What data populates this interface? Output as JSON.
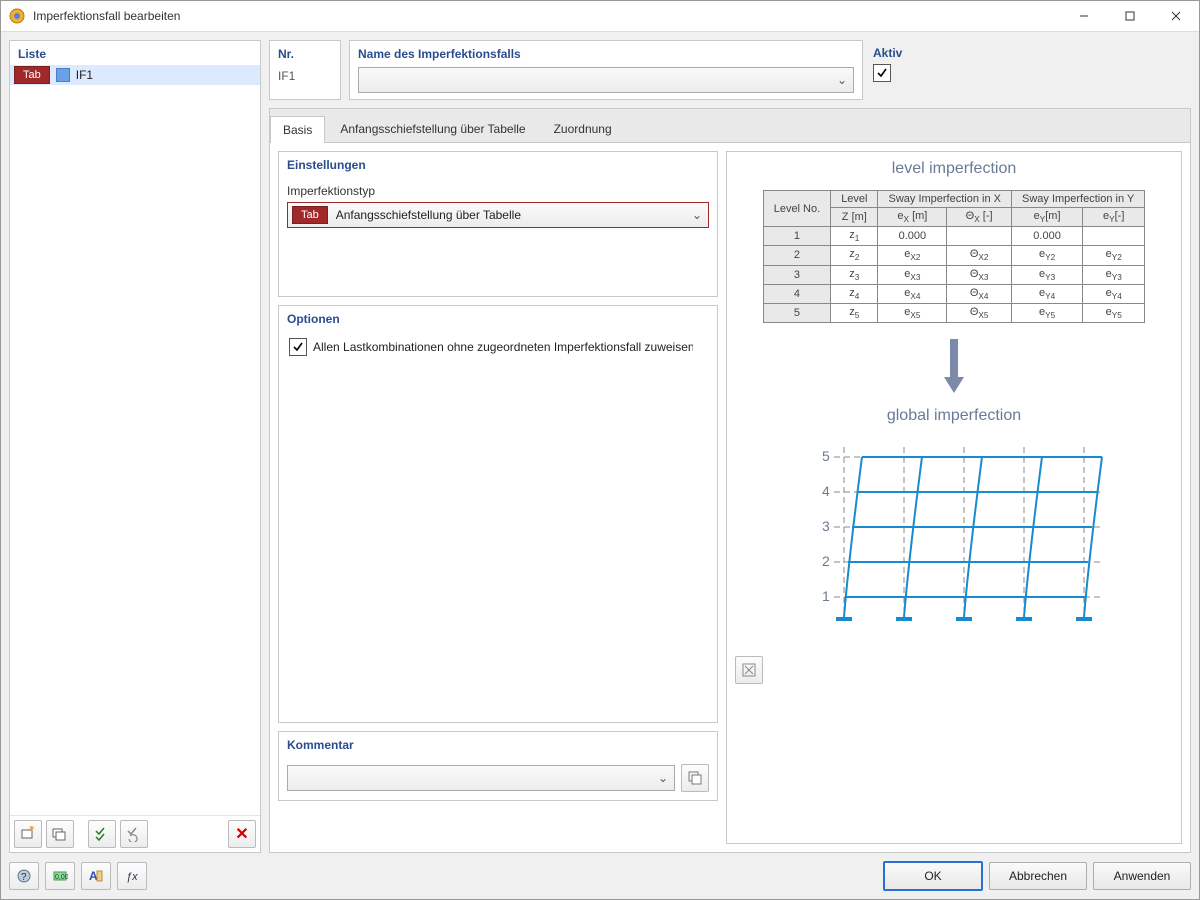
{
  "window": {
    "title": "Imperfektionsfall bearbeiten"
  },
  "liste": {
    "header": "Liste",
    "tab_chip": "Tab",
    "item": "IF1"
  },
  "nr": {
    "header": "Nr.",
    "value": "IF1"
  },
  "name": {
    "header": "Name des Imperfektionsfalls",
    "value": ""
  },
  "aktiv": {
    "header": "Aktiv",
    "checked": true
  },
  "tabs": {
    "t1": "Basis",
    "t2": "Anfangsschiefstellung über Tabelle",
    "t3": "Zuordnung"
  },
  "einstellungen": {
    "header": "Einstellungen",
    "typ_label": "Imperfektionstyp",
    "typ_tab": "Tab",
    "typ_value": "Anfangsschiefstellung über Tabelle"
  },
  "optionen": {
    "header": "Optionen",
    "chk_label": "Allen Lastkombinationen ohne zugeordneten Imperfektionsfall zuweisen"
  },
  "kommentar": {
    "header": "Kommentar",
    "value": ""
  },
  "preview": {
    "title1": "level imperfection",
    "title2": "global imperfection",
    "table": {
      "h_levelno": "Level No.",
      "h_level": "Level",
      "h_swayx": "Sway Imperfection in X",
      "h_swayy": "Sway Imperfection in Y",
      "h_z": "Z [m]",
      "h_ex": "eX [m]",
      "h_thx": "ΘX [-]",
      "h_ey": "eY[m]",
      "h_thy": "eY[-]",
      "rows": [
        {
          "n": "1",
          "z": "z1",
          "ex": "0.000",
          "thx": "",
          "ey": "0.000",
          "thy": ""
        },
        {
          "n": "2",
          "z": "z2",
          "ex": "eX2",
          "thx": "ΘX2",
          "ey": "eY2",
          "thy": "eY2"
        },
        {
          "n": "3",
          "z": "z3",
          "ex": "eX3",
          "thx": "ΘX3",
          "ey": "eY3",
          "thy": "eY3"
        },
        {
          "n": "4",
          "z": "z4",
          "ex": "eX4",
          "thx": "ΘX4",
          "ey": "eY4",
          "thy": "eY4"
        },
        {
          "n": "5",
          "z": "z5",
          "ex": "eX5",
          "thx": "ΘX5",
          "ey": "eY5",
          "thy": "eY5"
        }
      ]
    },
    "chart_data": {
      "type": "diagram",
      "levels": [
        1,
        2,
        3,
        4,
        5
      ],
      "columns": 5,
      "note": "schematic deformed grid illustrating global sway imperfection"
    }
  },
  "buttons": {
    "ok": "OK",
    "cancel": "Abbrechen",
    "apply": "Anwenden"
  }
}
